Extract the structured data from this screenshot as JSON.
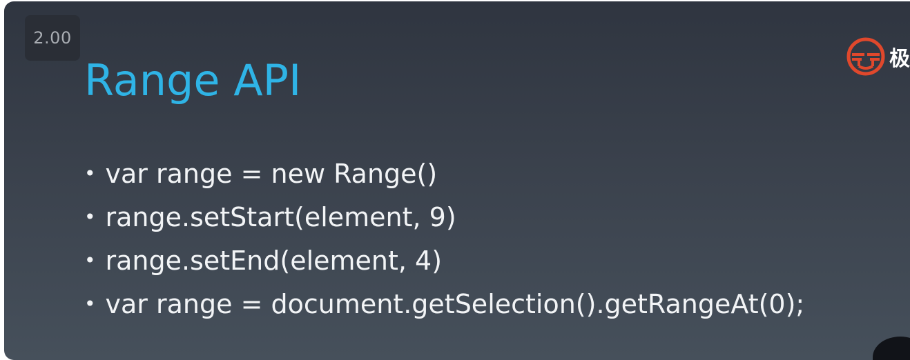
{
  "player": {
    "speed_label": "2.00"
  },
  "slide": {
    "title": "Range API",
    "logo_text": "极",
    "bullets": [
      "var range = new Range()",
      "range.setStart(element, 9)",
      "range.setEnd(element, 4)",
      "var range = document.getSelection().getRangeAt(0);"
    ]
  },
  "colors": {
    "title": "#2fb4e6",
    "logo": "#e0482c",
    "text": "#f2f4f6"
  },
  "icons": {
    "logo": "geektime-logo-icon",
    "bullet": "bullet-dot-icon"
  }
}
